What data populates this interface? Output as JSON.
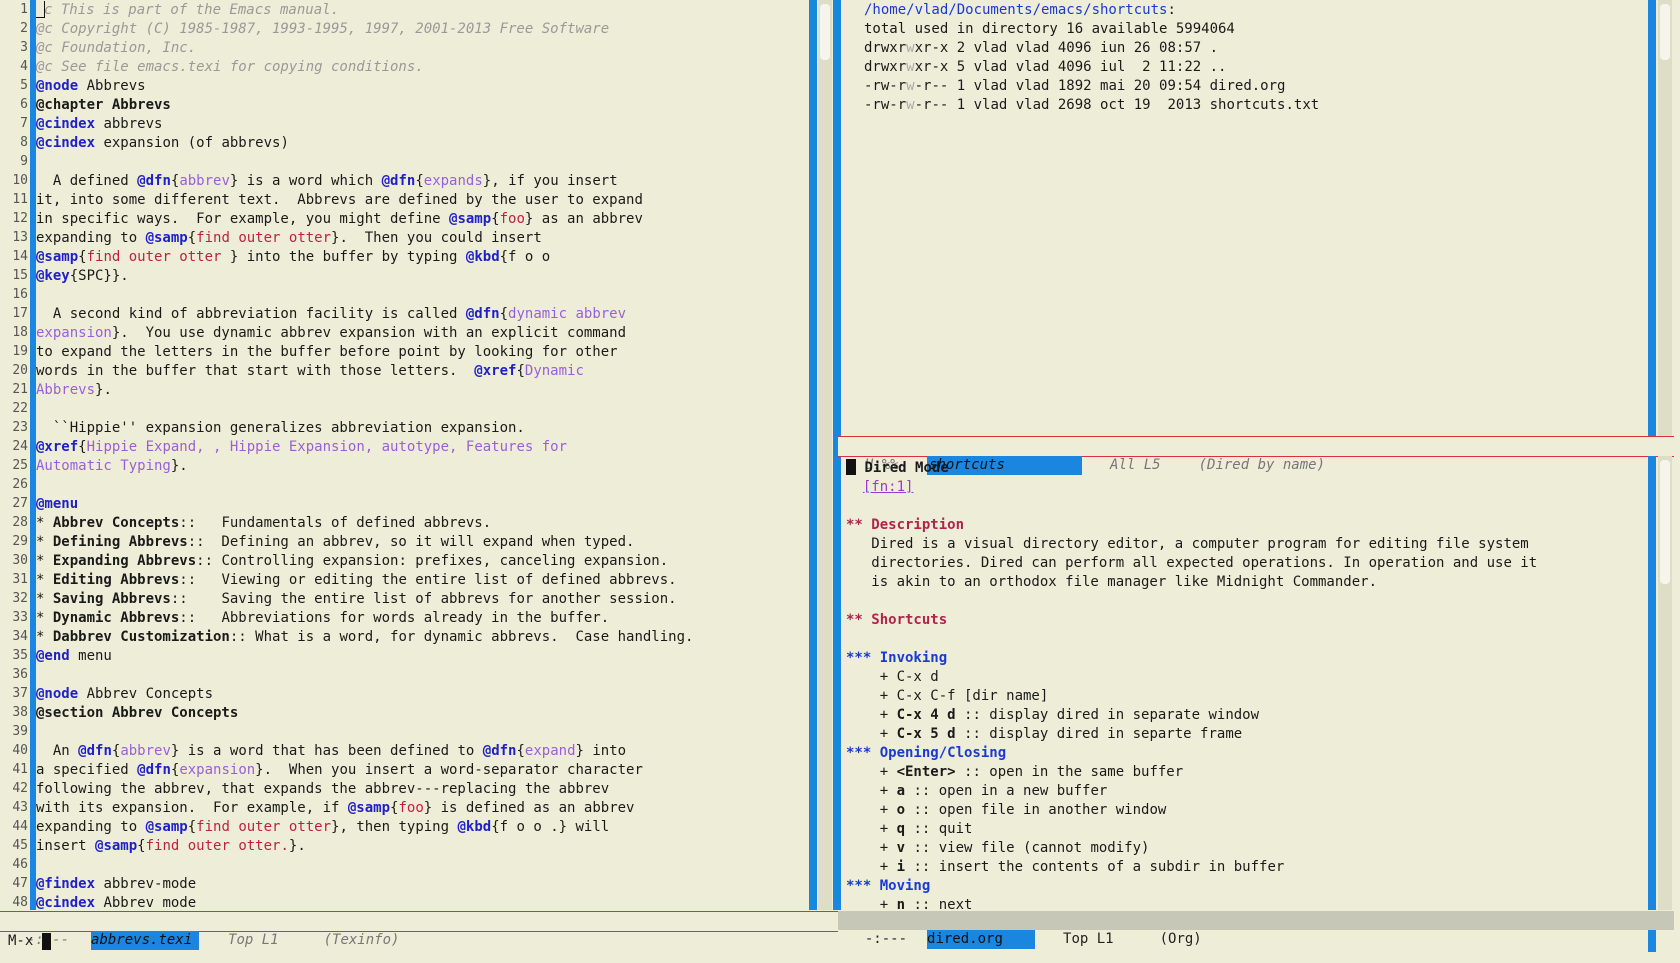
{
  "colors": {
    "fringe_blue": "#1a86e0",
    "mode_line_border": "#d8333b",
    "background": "#eeeed8"
  },
  "left_window": {
    "lines": [
      "@c This is part of the Emacs manual.",
      "@c Copyright (C) 1985-1987, 1993-1995, 1997, 2001-2013 Free Software",
      "@c Foundation, Inc.",
      "@c See file emacs.texi for copying conditions.",
      "@node Abbrevs",
      "@chapter Abbrevs",
      "@cindex abbrevs",
      "@cindex expansion (of abbrevs)",
      "",
      "  A defined @dfn{abbrev} is a word which @dfn{expands}, if you insert",
      "it, into some different text.  Abbrevs are defined by the user to expand",
      "in specific ways.  For example, you might define @samp{foo} as an abbrev",
      "expanding to @samp{find outer otter}.  Then you could insert",
      "@samp{find outer otter } into the buffer by typing @kbd{f o o",
      "@key{SPC}}.",
      "",
      "  A second kind of abbreviation facility is called @dfn{dynamic abbrev",
      "expansion}.  You use dynamic abbrev expansion with an explicit command",
      "to expand the letters in the buffer before point by looking for other",
      "words in the buffer that start with those letters.  @xref{Dynamic",
      "Abbrevs}.",
      "",
      "  ``Hippie'' expansion generalizes abbreviation expansion.",
      "@xref{Hippie Expand, , Hippie Expansion, autotype, Features for",
      "Automatic Typing}.",
      "",
      "@menu",
      "* Abbrev Concepts::   Fundamentals of defined abbrevs.",
      "* Defining Abbrevs::  Defining an abbrev, so it will expand when typed.",
      "* Expanding Abbrevs:: Controlling expansion: prefixes, canceling expansion.",
      "* Editing Abbrevs::   Viewing or editing the entire list of defined abbrevs.",
      "* Saving Abbrevs::    Saving the entire list of abbrevs for another session.",
      "* Dynamic Abbrevs::   Abbreviations for words already in the buffer.",
      "* Dabbrev Customization:: What is a word, for dynamic abbrevs.  Case handling.",
      "@end menu",
      "",
      "@node Abbrev Concepts",
      "@section Abbrev Concepts",
      "",
      "  An @dfn{abbrev} is a word that has been defined to @dfn{expand} into",
      "a specified @dfn{expansion}.  When you insert a word-separator character",
      "following the abbrev, that expands the abbrev---replacing the abbrev",
      "with its expansion.  For example, if @samp{foo} is defined as an abbrev",
      "expanding to @samp{find outer otter}, then typing @kbd{f o o .} will",
      "insert @samp{find outer otter.}.",
      "",
      "@findex abbrev-mode",
      "@cindex Abbrev mode"
    ],
    "mode_line": {
      "state": "-:---",
      "buffer": "abbrevs.texi",
      "position": "Top L1",
      "mode": "(Texinfo)"
    }
  },
  "dired_window": {
    "path": "/home/vlad/Documents/emacs/shortcuts:",
    "total": "total used in directory 16 available 5994064",
    "entries": [
      "drwxrwxr-x 2 vlad vlad 4096 iun 26 08:57 .",
      "drwxrwxr-x 5 vlad vlad 4096 iul  2 11:22 ..",
      "-rw-rw-r-- 1 vlad vlad 1892 mai 20 09:54 dired.org",
      "-rw-rw-r-- 1 vlad vlad 2698 oct 19  2013 shortcuts.txt"
    ],
    "mode_line": {
      "state": "U:%%-",
      "buffer": "shortcuts",
      "position": "All L5",
      "mode": "(Dired by name)"
    }
  },
  "org_window": {
    "lines": [
      "* Dired Mode",
      "  [fn:1]",
      "",
      "** Description",
      "   Dired is a visual directory editor, a computer program for editing file system",
      "   directories. Dired can perform all expected operations. In operation and use it",
      "   is akin to an orthodox file manager like Midnight Commander.",
      "",
      "** Shortcuts",
      "",
      "*** Invoking",
      "    + C-x d",
      "    + C-x C-f [dir name]",
      "    + C-x 4 d :: display dired in separate window",
      "    + C-x 5 d :: display dired in separte frame",
      "*** Opening/Closing",
      "    + <Enter> :: open in the same buffer",
      "    + a :: open in a new buffer",
      "    + o :: open file in another window",
      "    + q :: quit",
      "    + v :: view file (cannot modify)",
      "    + i :: insert the contents of a subdir in buffer",
      "*** Moving",
      "    + n :: next"
    ],
    "mode_line": {
      "state": "-:---",
      "buffer": "dired.org",
      "position": "Top L1",
      "mode": "(Org)"
    }
  },
  "minibuffer": {
    "prompt": "M-x "
  }
}
